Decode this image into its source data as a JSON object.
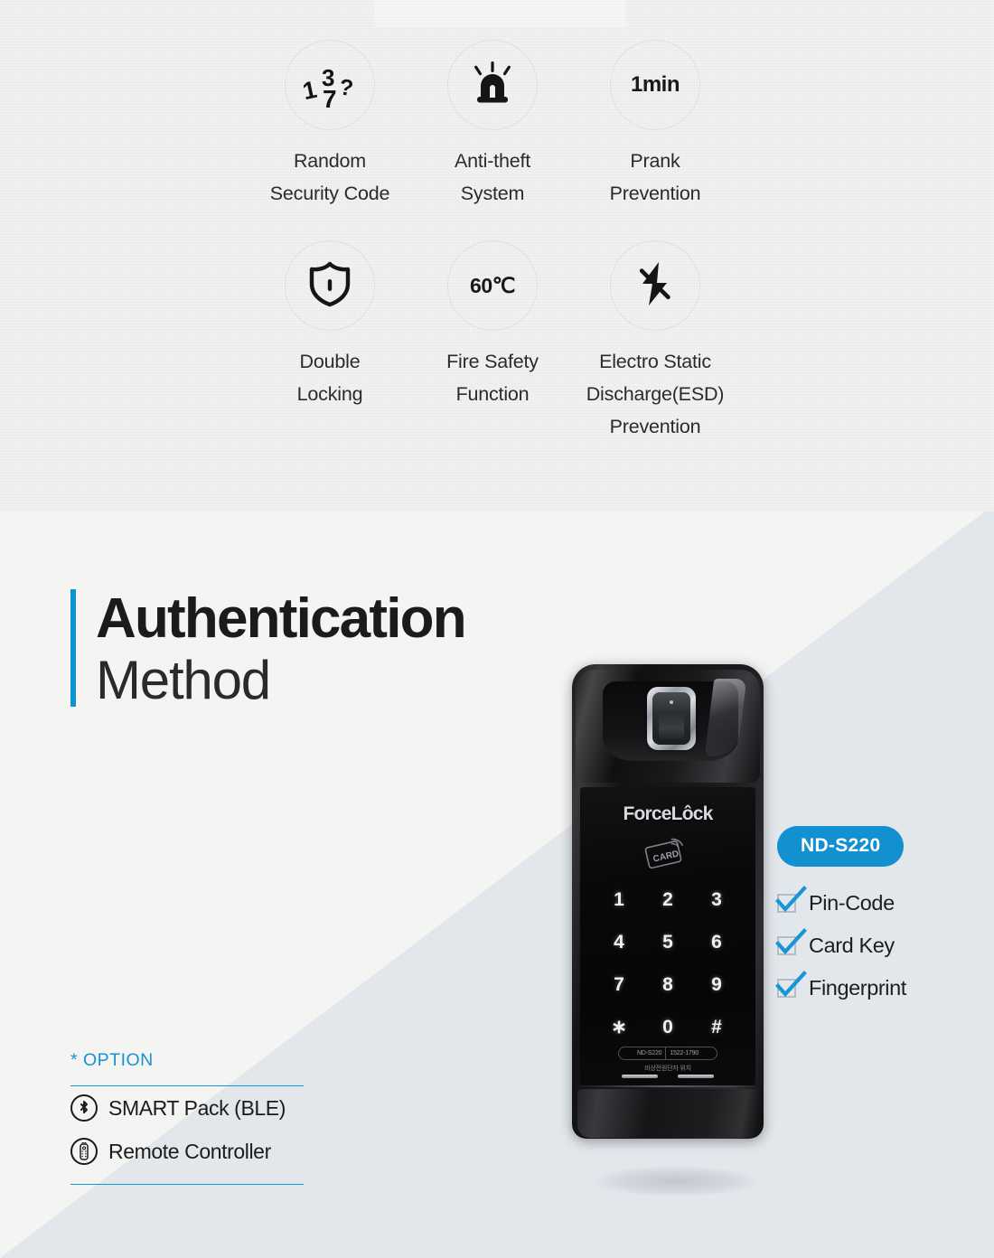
{
  "features": {
    "items": [
      {
        "icon": "random-number-icon",
        "icon_text": "",
        "label": "Random\nSecurity Code"
      },
      {
        "icon": "siren-alarm-icon",
        "icon_text": "",
        "label": "Anti-theft\nSystem"
      },
      {
        "icon": "one-minute-icon",
        "icon_text": "1min",
        "label": "Prank\nPrevention"
      },
      {
        "icon": "shield-lock-icon",
        "icon_text": "",
        "label": "Double\nLocking"
      },
      {
        "icon": "temperature-icon",
        "icon_text": "60℃",
        "label": "Fire Safety\nFunction"
      },
      {
        "icon": "no-electricity-icon",
        "icon_text": "",
        "label": "Electro Static\nDischarge(ESD)\nPrevention"
      }
    ]
  },
  "authentication": {
    "title_main": "Authentication",
    "title_sub": "Method",
    "accent_color": "#0d92d2",
    "badge_label": "ND-S220",
    "badge_color": "#1290d0",
    "methods": [
      {
        "label": "Pin-Code"
      },
      {
        "label": "Card Key"
      },
      {
        "label": "Fingerprint"
      }
    ]
  },
  "option": {
    "title": "* OPTION",
    "items": [
      {
        "icon": "bluetooth-icon",
        "label": "SMART Pack (BLE)"
      },
      {
        "icon": "remote-controller-icon",
        "label": "Remote Controller"
      }
    ]
  },
  "product": {
    "brand": "ForceLôck",
    "card_icon_label": "CARD",
    "keypad": [
      "1",
      "2",
      "3",
      "4",
      "5",
      "6",
      "7",
      "8",
      "9",
      "∗",
      "0",
      "#"
    ],
    "model_label": "ND-S220",
    "phone_label": "1522-1790",
    "notice_label": "비상전원단자 위치"
  }
}
